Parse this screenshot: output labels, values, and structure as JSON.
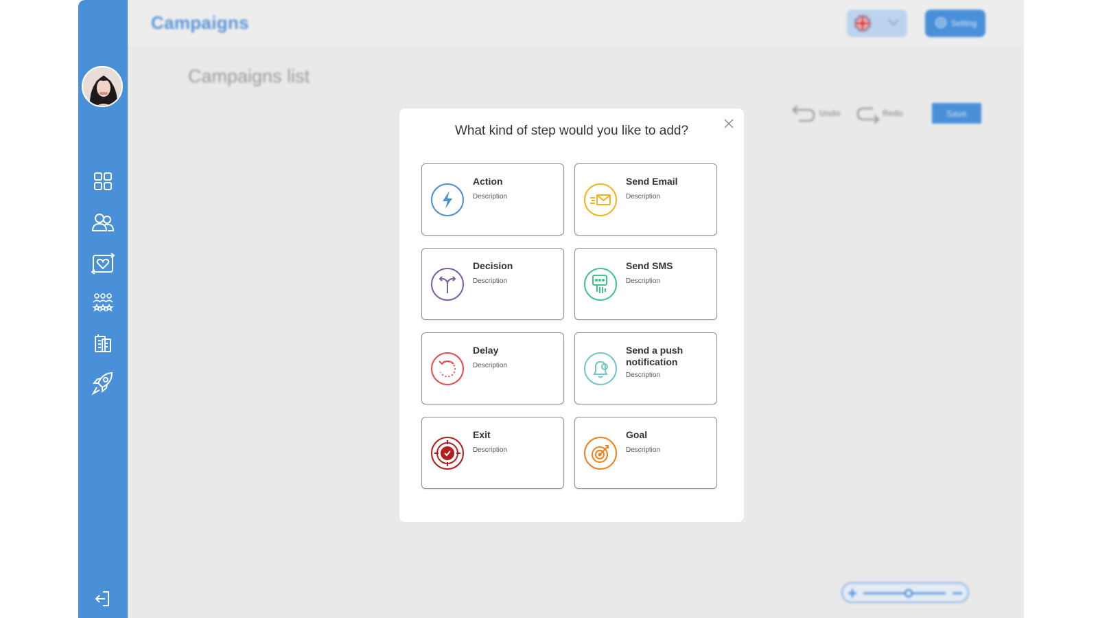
{
  "header": {
    "title": "Campaigns",
    "setting_label": "Setting"
  },
  "page": {
    "list_title": "Campaigns list"
  },
  "toolbar": {
    "undo_label": "Undo",
    "redo_label": "Redo",
    "save_label": "Save"
  },
  "modal": {
    "title": "What kind of step would you like to add?",
    "options": [
      {
        "name": "Action",
        "description": "Description",
        "icon": "lightning-icon",
        "color": "#4a90d9"
      },
      {
        "name": "Send Email",
        "description": "Description",
        "icon": "email-icon",
        "color": "#f2b21b"
      },
      {
        "name": "Decision",
        "description": "Description",
        "icon": "split-arrow-icon",
        "color": "#7b5ea7"
      },
      {
        "name": "Send SMS",
        "description": "Description",
        "icon": "sms-icon",
        "color": "#3cc48a"
      },
      {
        "name": "Delay",
        "description": "Description",
        "icon": "delay-icon",
        "color": "#e84b4b"
      },
      {
        "name": "Send a push notification",
        "description": "Description",
        "icon": "bell-icon",
        "color": "#6fc5c9"
      },
      {
        "name": "Exit",
        "description": "Description",
        "icon": "target-check-icon",
        "color": "#b01e1e"
      },
      {
        "name": "Goal",
        "description": "Description",
        "icon": "goal-icon",
        "color": "#f07f1c"
      }
    ]
  },
  "colors": {
    "sidebar": "#4a90d9",
    "accent": "#4a90d9"
  }
}
